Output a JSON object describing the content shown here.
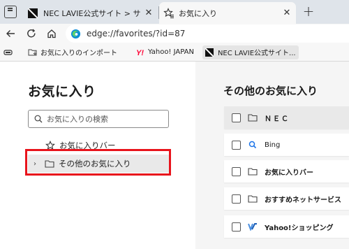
{
  "tabs": [
    {
      "title": "NEC LAVIE公式サイト > サービス&サ",
      "close": "✕"
    },
    {
      "title": "お気に入り",
      "close": "✕"
    }
  ],
  "new_tab_glyph": "+",
  "address": {
    "url": "edge://favorites/?id=87"
  },
  "favorites_bar": {
    "items": [
      {
        "label": "お気に入りのインポート",
        "icon": "folder-icon"
      },
      {
        "label": "Yahoo! JAPAN",
        "icon": "yahoo-icon"
      },
      {
        "label": "NEC LAVIE公式サイト...",
        "icon": "nec-icon"
      }
    ]
  },
  "left": {
    "title": "お気に入り",
    "search_placeholder": "お気に入りの検索",
    "tree": [
      {
        "label": "お気に入りバー"
      },
      {
        "label": "その他のお気に入り",
        "chevron": "›"
      }
    ]
  },
  "right": {
    "title": "その他のお気に入り",
    "rows": [
      {
        "label": "ＮＥＣ",
        "icon": "folder-icon"
      },
      {
        "label": "Bing",
        "icon": "search-icon"
      },
      {
        "label": "お気に入りバー",
        "icon": "folder-icon"
      },
      {
        "label": "おすすめネットサービス",
        "icon": "folder-icon"
      },
      {
        "label": "Yahoo!ショッピング",
        "icon": "yahoo-shopping-icon"
      }
    ]
  },
  "colors": {
    "highlight": "#e8141c",
    "tabstrip": "#dfe4ea",
    "bing": "#1a73e8",
    "yahoo": "#ff0033"
  }
}
